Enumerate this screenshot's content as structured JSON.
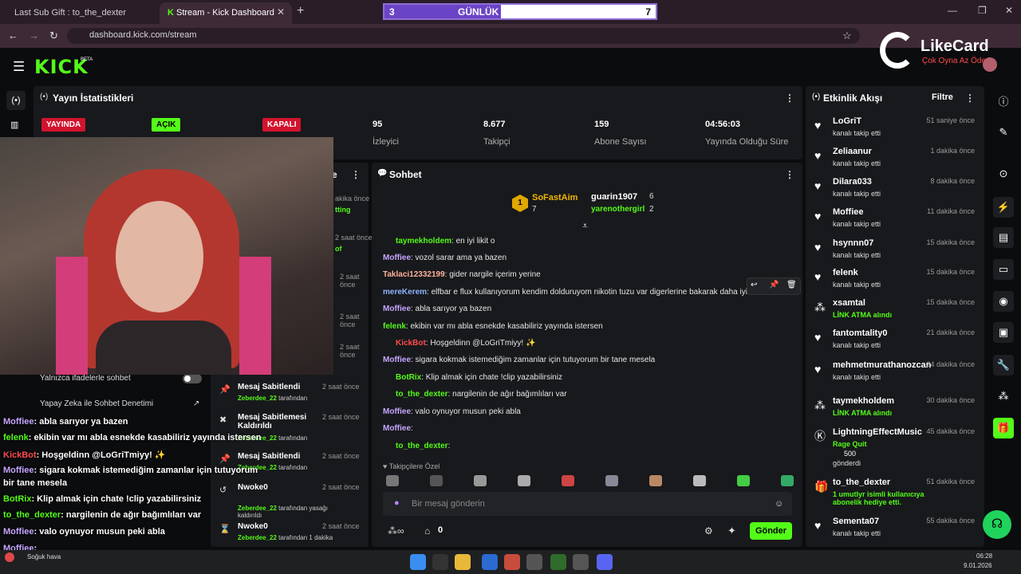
{
  "browser": {
    "tab1": "Last Sub Gift : to_the_dexter",
    "tab2": "Stream - Kick Dashboard",
    "url": "dashboard.kick.com/stream"
  },
  "goal": {
    "current": "3",
    "label": "GÜNLÜK ABONE HEDEFISI",
    "target": "7",
    "progress": 0.43
  },
  "brand": {
    "logo": "KICK",
    "beta": "BETA"
  },
  "overlay_logo": {
    "name": "LikeCard",
    "tagline": "Çok Oyna  Az Öde"
  },
  "stats": {
    "title": "Yayın İstatistikleri",
    "badges": [
      "YAYINDA",
      "AÇIK",
      "KAPALI"
    ],
    "items": [
      {
        "value": "95",
        "label": "İzleyici"
      },
      {
        "value": "8.677",
        "label": "Takipçi"
      },
      {
        "value": "159",
        "label": "Abone Sayısı"
      },
      {
        "value": "04:56:03",
        "label": "Yayında Olduğu Süre"
      }
    ]
  },
  "left_panel": {
    "e": "e",
    "times": [
      "akika önce",
      "2 saat önce",
      "2 saat önce",
      "2 saat önce",
      "2 saat önce"
    ],
    "frag1": "tting",
    "frag2": "of"
  },
  "settings": {
    "emote_only": "Yalnızca ifadelerle sohbet",
    "ai_mod": "Yapay Zeka ile Sohbet Denetimi"
  },
  "modlog": [
    {
      "title": "Mesaj Sabitlendi",
      "time": "2 saat önce",
      "user": "Zeberdee_22",
      "suffix": " tarafından"
    },
    {
      "title": "Mesaj Sabitlemesi Kaldırıldı",
      "time": "2 saat önce",
      "user": "Zeberdee_22",
      "suffix": " tarafından"
    },
    {
      "title": "Mesaj Sabitlendi",
      "time": "2 saat önce",
      "user": "Zeberdee_22",
      "suffix": " tarafından"
    },
    {
      "title": "Nwoke0",
      "time": "2 saat önce",
      "user": "Zeberdee_22",
      "suffix": " tarafından yasağı kaldırıldı"
    },
    {
      "title": "Nwoke0",
      "time": "2 saat önce",
      "user": "Zeberdee_22",
      "suffix": " tarafından 1 dakika"
    }
  ],
  "chat": {
    "title": "Sohbet",
    "leader1": {
      "name": "SoFastAim",
      "count": "7"
    },
    "leader2": {
      "name": "guarin1907",
      "count": "6"
    },
    "leader3": {
      "name": "yarenothergirl",
      "count": "2"
    },
    "messages": [
      {
        "user": "taymekholdem",
        "text": ": en iyi likit o",
        "color": "#53fc18"
      },
      {
        "user": "Moffiee",
        "text": ": vozol sarar ama ya bazen",
        "color": "#c6a5ff"
      },
      {
        "user": "Taklaci12332199",
        "text": ": gider nargile içerim yerine",
        "color": "#ffb199"
      },
      {
        "user": "mereKerem",
        "text": ": elfbar e flux kullanıyorum kendim dolduruyom nikotin tuzu var digerlerine bakarak daha iyi :s",
        "color": "#8ab4ff"
      },
      {
        "user": "Moffiee",
        "text": ": abla sarıyor ya bazen",
        "color": "#c6a5ff"
      },
      {
        "user": "felenk",
        "text": ": ekibin var mı abla esnekde kasabiliriz yayında istersen",
        "color": "#53fc18"
      },
      {
        "user": "KickBot",
        "text": ": Hoşgeldinn @LoGriTmiyy! ✨",
        "color": "#ff4d4d"
      },
      {
        "user": "Moffiee",
        "text": ": sigara kokmak istemediğim zamanlar için tutuyorum bir tane mesela",
        "color": "#c6a5ff"
      },
      {
        "user": "BotRix",
        "text": ": Klip almak için chate !clip yazabilirsiniz",
        "color": "#53fc18"
      },
      {
        "user": "to_the_dexter",
        "text": ": nargilenin de ağır bağımlıları var",
        "color": "#53fc18"
      },
      {
        "user": "Moffiee",
        "text": ": valo oynuyor musun peki abla",
        "color": "#c6a5ff"
      },
      {
        "user": "Moffiee",
        "text": ":",
        "color": "#c6a5ff"
      },
      {
        "user": "to_the_dexter",
        "text": ":",
        "color": "#53fc18"
      }
    ],
    "emote_label": "Takipçilere Özel",
    "placeholder": "Bir mesaj gönderin",
    "points": "0",
    "send": "Gönder"
  },
  "activity": {
    "title": "Etkinlik Akışı",
    "filter": "Filtre",
    "items": [
      {
        "name": "LoGriT",
        "sub": "kanalı takip etti",
        "time": "51 saniye önce"
      },
      {
        "name": "Zeliaanur",
        "sub": "kanalı takip etti",
        "time": "1 dakika önce"
      },
      {
        "name": "Dilara033",
        "sub": "kanalı takip etti",
        "time": "8 dakika önce"
      },
      {
        "name": "Moffiee",
        "sub": "kanalı takip etti",
        "time": "11 dakika önce"
      },
      {
        "name": "hsynnn07",
        "sub": "kanalı takip etti",
        "time": "15 dakika önce"
      },
      {
        "name": "felenk",
        "sub": "kanalı takip etti",
        "time": "15 dakika önce"
      },
      {
        "name": "xsamtal",
        "sub": "LİNK ATMA alındı",
        "time": "15 dakika önce"
      },
      {
        "name": "fantomtality0",
        "sub": "kanalı takip etti",
        "time": "21 dakika önce"
      },
      {
        "name": "mehmetmurathanozcan",
        "sub": "kanalı takip etti",
        "time": "24 dakika önce"
      },
      {
        "name": "taymekholdem",
        "sub": "LİNK ATMA alındı",
        "time": "30 dakika önce"
      },
      {
        "name": "LightningEffectMusic",
        "sub": "Rage Quit",
        "time": "45 dakika önce",
        "extra": "500",
        "extra2": "gönderdi"
      },
      {
        "name": "to_the_dexter",
        "sub": "1 umutlyr isimli kullanıcıya abonelik hediye etti.",
        "time": "51 dakika önce"
      },
      {
        "name": "Sementa07",
        "sub": "kanalı takip etti",
        "time": "55 dakika önce"
      }
    ]
  },
  "overlay_chat": [
    {
      "user": "Moffiee",
      "text": ": abla sarıyor ya bazen"
    },
    {
      "user": "felenk",
      "text": ": ekibin var mı abla esnekde kasabiliriz yayında istersen"
    },
    {
      "user": "KickBot",
      "text": ": Hoşgeldinn @LoGriTmiyy! ✨"
    },
    {
      "user": "Moffiee",
      "text": ": sigara kokmak istemediğim zamanlar için tutuyorum"
    },
    {
      "user": "",
      "text": "bir tane mesela"
    },
    {
      "user": "BotRix",
      "text": ": Klip almak için chate !clip yazabilirsiniz"
    },
    {
      "user": "to_the_dexter",
      "text": ": nargilenin de ağır bağımlıları var"
    },
    {
      "user": "Moffiee",
      "text": ": valo oynuyor musun peki abla"
    },
    {
      "user": "Moffiee",
      "text": ":"
    },
    {
      "user": "to_the_dexter",
      "text": ":"
    }
  ],
  "taskbar": {
    "weather": "Soğuk hava",
    "time": "06:28",
    "date": "9.01.2026"
  }
}
